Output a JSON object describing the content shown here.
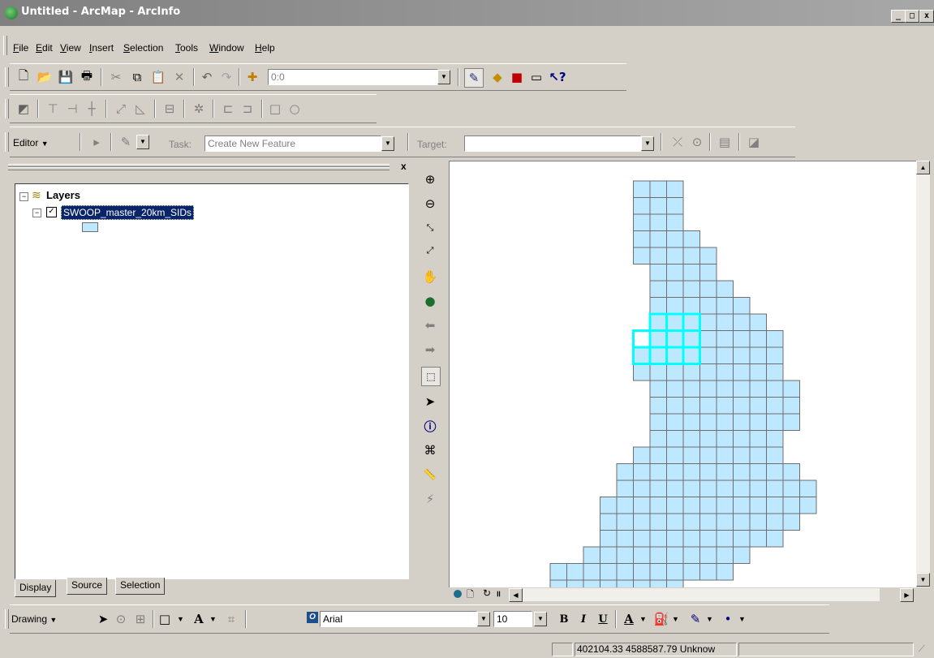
{
  "window": {
    "title": "Untitled - ArcMap - ArcInfo",
    "min": "_",
    "max": "□",
    "close": "x"
  },
  "menu": [
    {
      "label": "File",
      "u": "F",
      "rest": "ile"
    },
    {
      "label": "Edit",
      "u": "E",
      "rest": "dit"
    },
    {
      "label": "View",
      "u": "V",
      "rest": "iew"
    },
    {
      "label": "Insert",
      "u": "I",
      "rest": "nsert"
    },
    {
      "label": "Selection",
      "u": "S",
      "rest": "election"
    },
    {
      "label": "Tools",
      "u": "T",
      "rest": "ools"
    },
    {
      "label": "Window",
      "u": "W",
      "rest": "indow"
    },
    {
      "label": "Help",
      "u": "H",
      "rest": "elp"
    }
  ],
  "standard_toolbar": {
    "scale_value": "0:0"
  },
  "editor_toolbar": {
    "editor_label": "Editor",
    "task_label": "Task:",
    "task_value": "Create New Feature",
    "target_label": "Target:",
    "target_value": ""
  },
  "toc": {
    "root_label": "Layers",
    "layer_name": "SWOOP_master_20km_SIDs",
    "symbol_color": "#bee8ff",
    "tabs": [
      "Display",
      "Source",
      "Selection"
    ]
  },
  "map": {
    "fill_color": "#bee8ff",
    "outline_color": "#6e6e6e",
    "selection_color": "#00ffff"
  },
  "drawing_toolbar": {
    "drawing_label": "Drawing",
    "font_value": "Arial",
    "size_value": "10"
  },
  "status": {
    "coordinates": "402104.33  4588587.79 Unknow"
  }
}
